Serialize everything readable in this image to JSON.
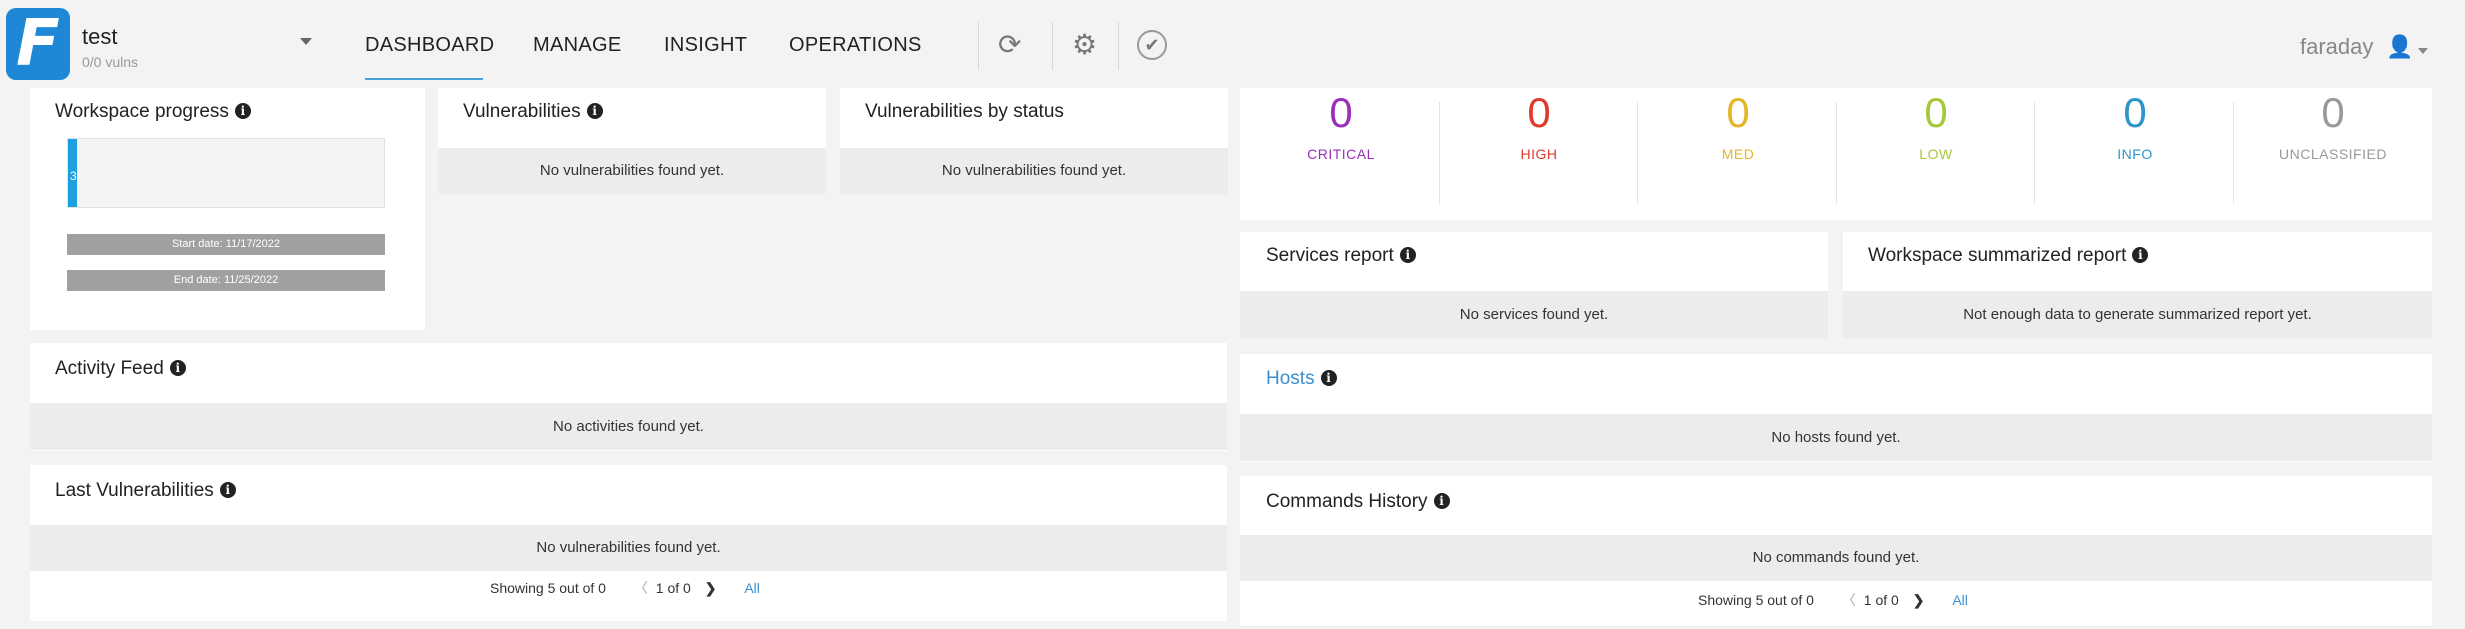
{
  "header": {
    "workspace_name": "test",
    "workspace_vulns": "0/0 vulns",
    "nav": [
      "DASHBOARD",
      "MANAGE",
      "INSIGHT",
      "OPERATIONS"
    ],
    "user": "faraday",
    "logo_letter": "F"
  },
  "workspace_progress": {
    "title": "Workspace progress",
    "progress_label": "3",
    "progress_fraction": 0.03,
    "start_date": "Start date: 11/17/2022",
    "end_date": "End date: 11/25/2022"
  },
  "vulnerabilities": {
    "title": "Vulnerabilities",
    "empty": "No vulnerabilities found yet."
  },
  "vulns_by_status": {
    "title": "Vulnerabilities by status",
    "empty": "No vulnerabilities found yet."
  },
  "severity": [
    {
      "count": "0",
      "label": "CRITICAL",
      "color": "#9b2fb8"
    },
    {
      "count": "0",
      "label": "HIGH",
      "color": "#e03a2f"
    },
    {
      "count": "0",
      "label": "MED",
      "color": "#e3b72a"
    },
    {
      "count": "0",
      "label": "LOW",
      "color": "#a6c83a"
    },
    {
      "count": "0",
      "label": "INFO",
      "color": "#2c96c9"
    },
    {
      "count": "0",
      "label": "UNCLASSIFIED",
      "color": "#999999"
    }
  ],
  "services_report": {
    "title": "Services report",
    "empty": "No services found yet."
  },
  "summarized_report": {
    "title": "Workspace summarized report",
    "empty": "Not enough data to generate summarized report yet."
  },
  "activity_feed": {
    "title": "Activity Feed",
    "empty": "No activities found yet."
  },
  "hosts": {
    "title": "Hosts",
    "empty": "No hosts found yet."
  },
  "last_vulns": {
    "title": "Last Vulnerabilities",
    "empty": "No vulnerabilities found yet.",
    "showing": "Showing 5 out of 0",
    "page": "1 of 0",
    "all": "All"
  },
  "commands_history": {
    "title": "Commands History",
    "empty": "No commands found yet.",
    "showing": "Showing 5 out of 0",
    "page": "1 of 0",
    "all": "All"
  },
  "pager_prev": "〈",
  "pager_next": "❯"
}
